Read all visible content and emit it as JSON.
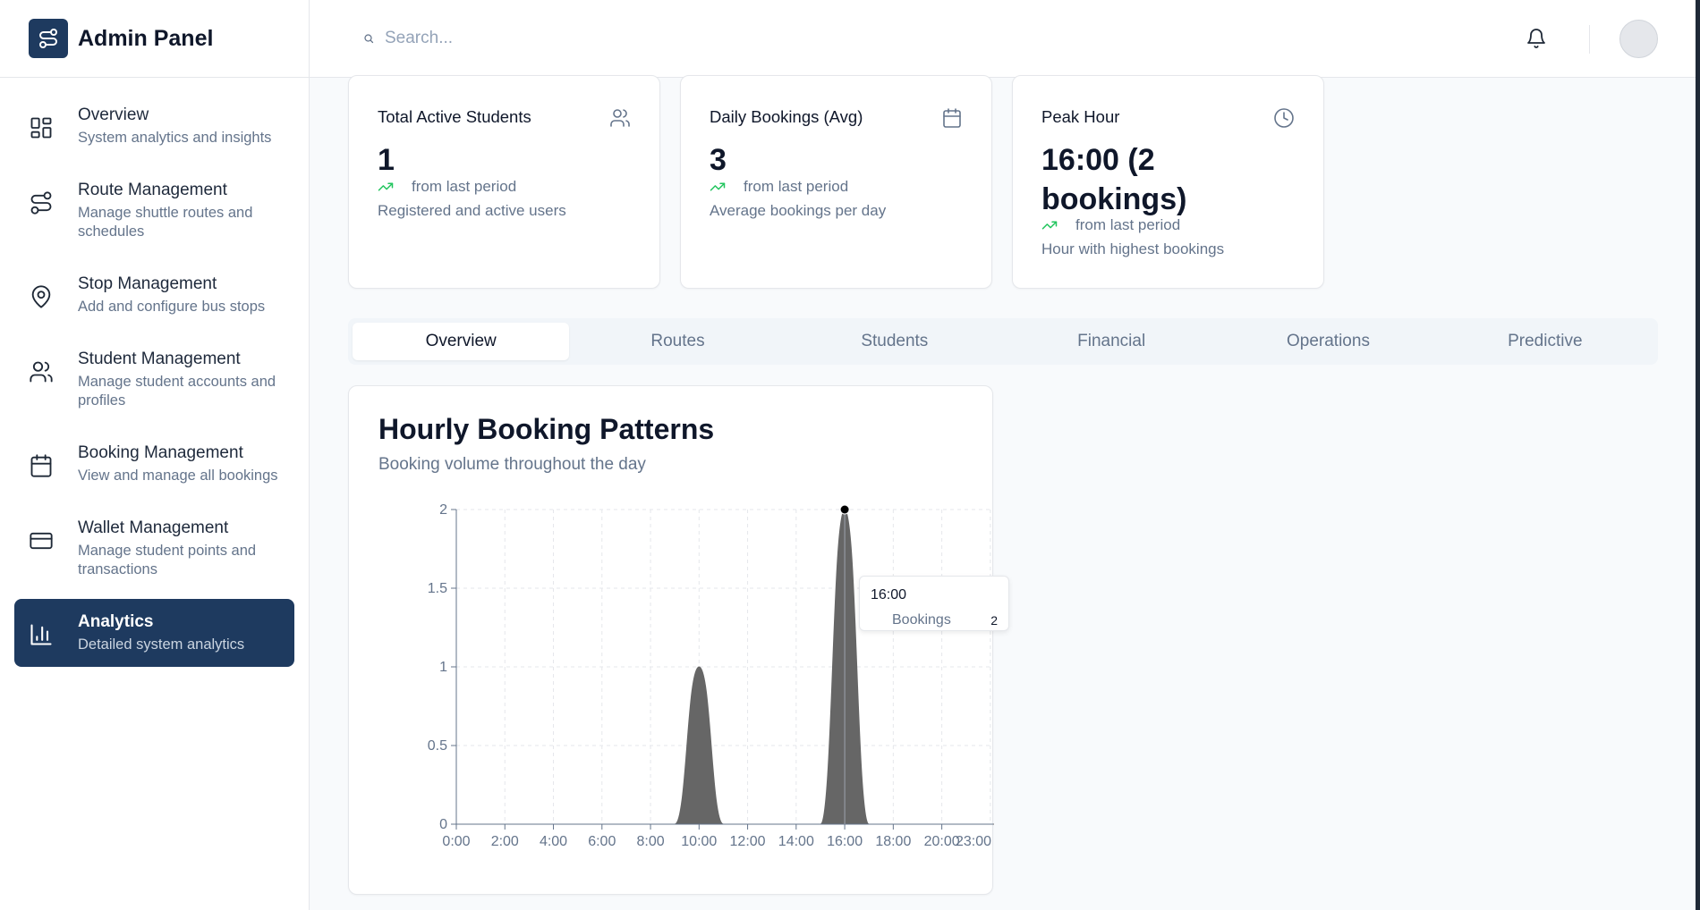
{
  "app": {
    "title": "Admin Panel"
  },
  "sidebar": {
    "items": [
      {
        "label": "Overview",
        "description": "System analytics and insights",
        "icon": "grid-icon",
        "active": false
      },
      {
        "label": "Route Management",
        "description": "Manage shuttle routes and schedules",
        "icon": "route-icon",
        "active": false
      },
      {
        "label": "Stop Management",
        "description": "Add and configure bus stops",
        "icon": "map-pin-icon",
        "active": false
      },
      {
        "label": "Student Management",
        "description": "Manage student accounts and profiles",
        "icon": "users-icon",
        "active": false
      },
      {
        "label": "Booking Management",
        "description": "View and manage all bookings",
        "icon": "calendar-icon",
        "active": false
      },
      {
        "label": "Wallet Management",
        "description": "Manage student points and transactions",
        "icon": "credit-card-icon",
        "active": false
      },
      {
        "label": "Analytics",
        "description": "Detailed system analytics",
        "icon": "bar-chart-icon",
        "active": true
      }
    ]
  },
  "header": {
    "search_placeholder": "Search...",
    "search_value": ""
  },
  "stats": [
    {
      "title": "Total Active Students",
      "value": "1",
      "trend": "from last period",
      "subtitle": "Registered and active users",
      "icon": "users-icon"
    },
    {
      "title": "Daily Bookings (Avg)",
      "value": "3",
      "trend": "from last period",
      "subtitle": "Average bookings per day",
      "icon": "calendar-icon"
    },
    {
      "title": "Peak Hour",
      "value": "16:00 (2 bookings)",
      "trend": "from last period",
      "subtitle": "Hour with highest bookings",
      "icon": "clock-icon"
    }
  ],
  "tabs": [
    {
      "label": "Overview",
      "active": true
    },
    {
      "label": "Routes",
      "active": false
    },
    {
      "label": "Students",
      "active": false
    },
    {
      "label": "Financial",
      "active": false
    },
    {
      "label": "Operations",
      "active": false
    },
    {
      "label": "Predictive",
      "active": false
    }
  ],
  "chart_card": {
    "title": "Hourly Booking Patterns",
    "subtitle": "Booking volume throughout the day",
    "tooltip": {
      "time": "16:00",
      "label": "Bookings",
      "value": "2"
    }
  },
  "colors": {
    "brand": "#1e3a5f",
    "area_fill": "#666666",
    "trend_up": "#22c55e"
  },
  "chart_data": {
    "type": "area",
    "title": "Hourly Booking Patterns",
    "subtitle": "Booking volume throughout the day",
    "x": [
      "0:00",
      "1:00",
      "2:00",
      "3:00",
      "4:00",
      "5:00",
      "6:00",
      "7:00",
      "8:00",
      "9:00",
      "10:00",
      "11:00",
      "12:00",
      "13:00",
      "14:00",
      "15:00",
      "16:00",
      "17:00",
      "18:00",
      "19:00",
      "20:00",
      "21:00",
      "22:00",
      "23:00"
    ],
    "x_tick_labels": [
      "0:00",
      "2:00",
      "4:00",
      "6:00",
      "8:00",
      "10:00",
      "12:00",
      "14:00",
      "16:00",
      "18:00",
      "20:00",
      "23:00"
    ],
    "series": [
      {
        "name": "Bookings",
        "values": [
          0,
          0,
          0,
          0,
          0,
          0,
          0,
          0,
          0,
          0,
          1,
          0,
          0,
          0,
          0,
          0,
          2,
          0,
          0,
          0,
          0,
          0,
          0,
          0
        ]
      }
    ],
    "ylim": [
      0,
      2
    ],
    "y_tick_labels": [
      "0",
      "0.5",
      "1",
      "1.5",
      "2"
    ],
    "y_ticks": [
      0,
      0.5,
      1,
      1.5,
      2
    ],
    "grid": true,
    "active_point": {
      "x": "16:00",
      "y": 2
    }
  }
}
